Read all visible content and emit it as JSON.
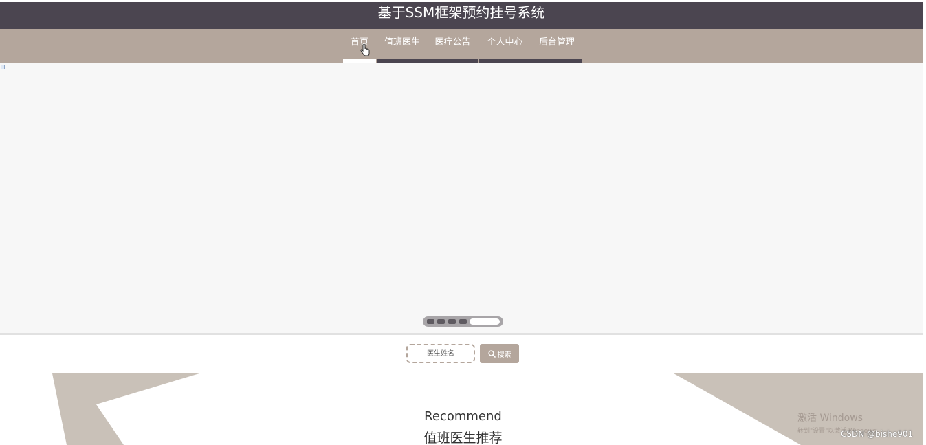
{
  "header": {
    "title": "基于SSM框架预约挂号系统"
  },
  "nav": {
    "items": [
      {
        "label": "首页",
        "active": true
      },
      {
        "label": "值班医生",
        "active": false
      },
      {
        "label": "医疗公告",
        "active": false
      },
      {
        "label": "个人中心",
        "active": false
      },
      {
        "label": "后台管理",
        "active": false
      }
    ]
  },
  "carousel": {
    "slide_count": 5,
    "active_index": 4
  },
  "search": {
    "placeholder": "医生姓名",
    "value": "",
    "button_label": "搜索",
    "button_icon": "search-icon"
  },
  "recommend": {
    "title_en": "Recommend",
    "title_cn": "值班医生推荐"
  },
  "watermarks": {
    "windows_title": "激活 Windows",
    "windows_sub": "转到\"设置\"以激活 Windows。",
    "csdn": "CSDN @bishe901"
  },
  "colors": {
    "header_bg": "#4b4550",
    "nav_bg": "#b4a69c",
    "accent": "#b4a69c",
    "banner_bg": "#f7f7f7",
    "decor": "#c9c1b8"
  }
}
